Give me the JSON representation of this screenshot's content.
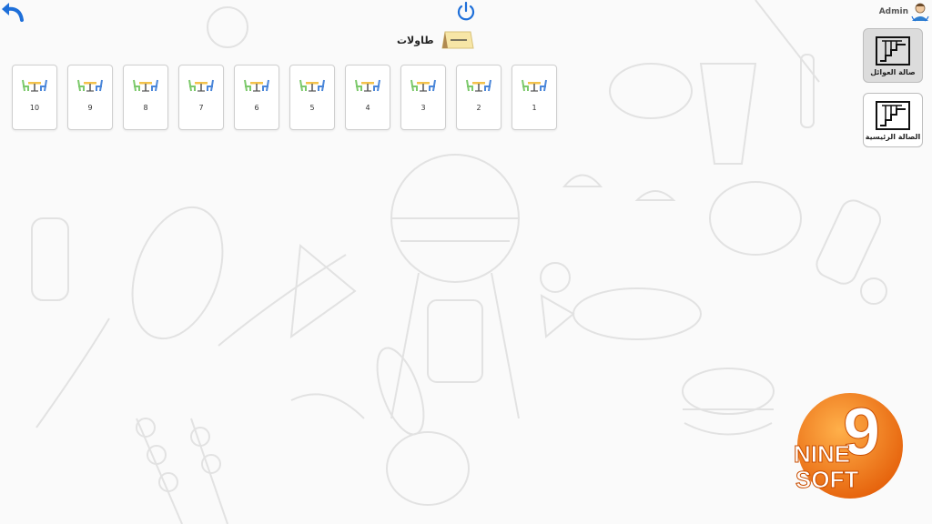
{
  "header": {
    "user_name": "Admin",
    "back_icon": "undo-arrow-icon",
    "power_icon": "power-icon",
    "accent_color": "#1e6fd9"
  },
  "section": {
    "title": "طاولات",
    "icon": "table-tent-icon"
  },
  "tables": [
    {
      "number": "1"
    },
    {
      "number": "2"
    },
    {
      "number": "3"
    },
    {
      "number": "4"
    },
    {
      "number": "5"
    },
    {
      "number": "6"
    },
    {
      "number": "7"
    },
    {
      "number": "8"
    },
    {
      "number": "9"
    },
    {
      "number": "10"
    }
  ],
  "halls": [
    {
      "label": "صالة العوائل",
      "icon": "stairs-icon",
      "active": true
    },
    {
      "label": "الصالة الرئيسية",
      "icon": "stairs-icon",
      "active": false
    }
  ],
  "brand": {
    "line1": "NINE",
    "line2": "SOFT",
    "digit": "9",
    "color": "#f47a10"
  }
}
